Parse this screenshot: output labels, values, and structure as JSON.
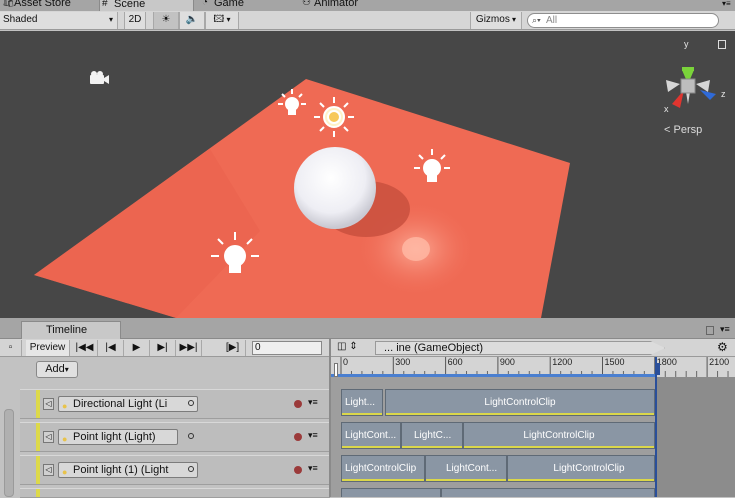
{
  "tabs": [
    {
      "label": "Asset Store",
      "icon": "asset-store-icon"
    },
    {
      "label": "Scene",
      "icon": "grid-icon"
    },
    {
      "label": "Game",
      "icon": "pacman-icon"
    },
    {
      "label": "Animator",
      "icon": "animator-icon"
    }
  ],
  "scene_toolbar": {
    "shading_mode": "Shaded",
    "twod_label": "2D",
    "gizmos_label": "Gizmos",
    "search_placeholder": "All"
  },
  "scene": {
    "persp_label": "Persp",
    "gizmo_axes": [
      "y",
      "x",
      "z"
    ],
    "colors": {
      "background": "#474747",
      "plane": "#f06a55",
      "sphere": "#f3f3f7"
    }
  },
  "timeline": {
    "tab_label": "Timeline",
    "preview_label": "Preview",
    "frame_value": "0",
    "add_label": "Add",
    "binding_title": "... ine (GameObject)",
    "ruler_ticks": [
      "0",
      "300",
      "600",
      "900",
      "1200",
      "1500",
      "1800",
      "2100"
    ],
    "tracks": [
      {
        "object": "Directional Light (Li",
        "clips": [
          "Light...",
          "LightControlClip"
        ]
      },
      {
        "object": "Point light (Light)",
        "clips": [
          "LightCont...",
          "LightC...",
          "LightControlClip"
        ]
      },
      {
        "object": "Point light (1) (Light",
        "clips": [
          "LightControlClip",
          "LightCont...",
          "LightControlClip"
        ]
      }
    ]
  }
}
